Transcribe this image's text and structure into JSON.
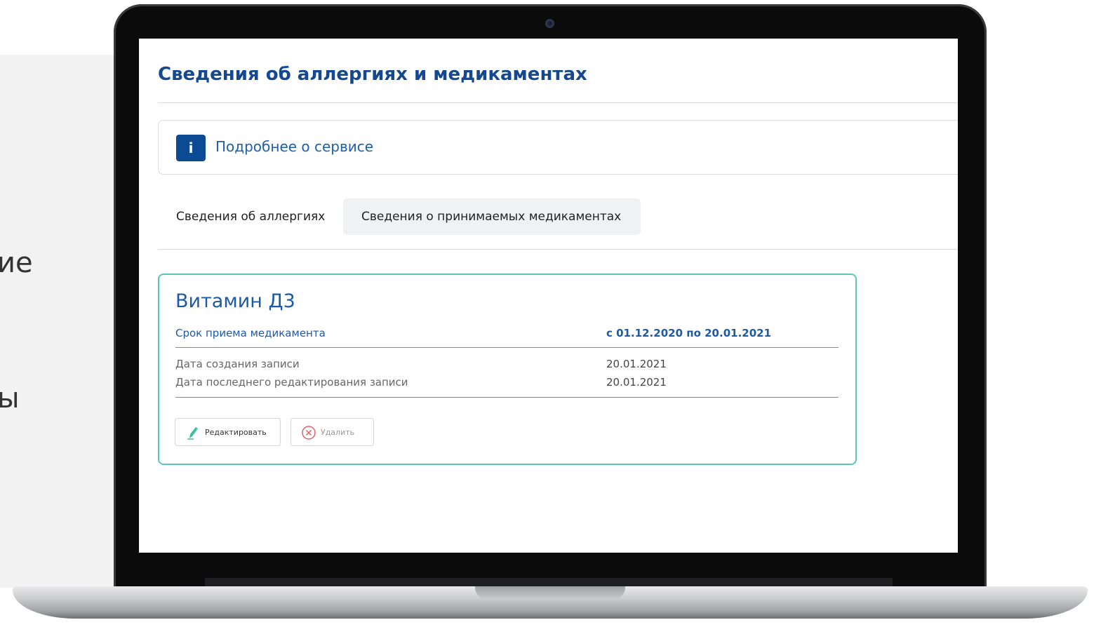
{
  "background": {
    "side_text_1": "ие",
    "side_text_2": "ы"
  },
  "page": {
    "title": "Сведения об аллергиях и медикаментах",
    "info_link": "Подробнее о сервисе",
    "info_icon_glyph": "i"
  },
  "tabs": [
    {
      "label": "Сведения об аллергиях",
      "active": false
    },
    {
      "label": "Сведения о принимаемых медикаментах",
      "active": true
    }
  ],
  "card": {
    "name": "Витамин Д3",
    "period_label": "Срок приема медикамента",
    "period_value": "с 01.12.2020 по 20.01.2021",
    "created_label": "Дата создания записи",
    "created_value": "20.01.2021",
    "edited_label": "Дата последнего редактирования записи",
    "edited_value": "20.01.2021",
    "edit_button": "Редактировать",
    "delete_button": "Удалить"
  },
  "colors": {
    "title": "#14488f",
    "accent_border": "#5cc7b6",
    "info_icon_bg": "#0c4a94",
    "delete_icon": "#e0606a",
    "edit_icon": "#3dbf9a"
  },
  "icons": {
    "info": "info-icon",
    "edit": "pencil-icon",
    "delete": "close-circle-icon",
    "camera": "camera-icon"
  }
}
